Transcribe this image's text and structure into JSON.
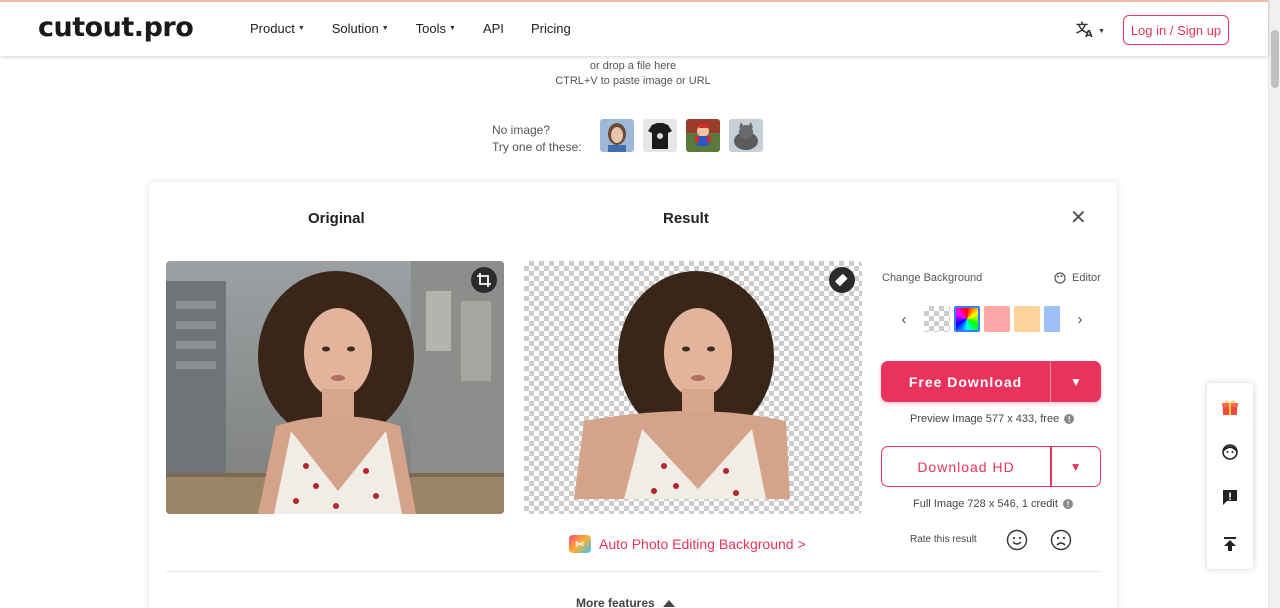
{
  "header": {
    "logo": "cutout.pro",
    "nav": [
      "Product",
      "Solution",
      "Tools",
      "API",
      "Pricing"
    ],
    "nav_has_caret": [
      true,
      true,
      true,
      false,
      false
    ],
    "login_label": "Log in / Sign up"
  },
  "upload": {
    "drop_hint": "or drop a file here",
    "paste_hint": "CTRL+V to paste image or URL",
    "no_image": "No image?",
    "try_one": "Try one of these:"
  },
  "workspace": {
    "original_title": "Original",
    "result_title": "Result",
    "auto_link": "Auto Photo Editing Background >",
    "more_features": "More features"
  },
  "panel": {
    "change_bg": "Change Background",
    "editor": "Editor",
    "swatch_colors": [
      "#fba7a7",
      "#fcd49b",
      "#9dc0f9"
    ],
    "free_download": "Free Download",
    "preview_note": "Preview Image 577 x 433, free",
    "download_hd": "Download HD",
    "full_note": "Full Image 728 x 546, 1 credit",
    "rate": "Rate this result"
  },
  "colors": {
    "accent": "#e8345c"
  }
}
